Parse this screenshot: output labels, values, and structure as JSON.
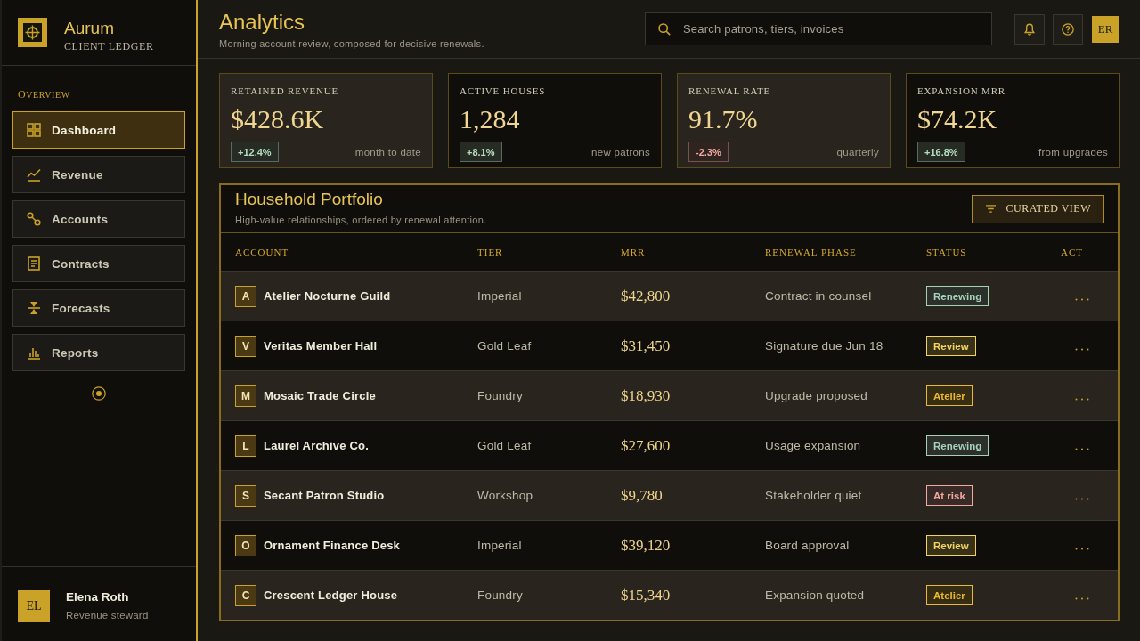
{
  "sidebar": {
    "brand": {
      "name": "Aurum",
      "tagline": "CLIENT LEDGER"
    },
    "section_label": "OVERVIEW",
    "items": [
      {
        "label": "Dashboard",
        "selected": true
      },
      {
        "label": "Revenue",
        "selected": false
      },
      {
        "label": "Accounts",
        "selected": false
      },
      {
        "label": "Contracts",
        "selected": false
      },
      {
        "label": "Forecasts",
        "selected": false
      },
      {
        "label": "Reports",
        "selected": false
      }
    ],
    "user": {
      "initials": "EL",
      "name": "Elena Roth",
      "role": "Revenue steward"
    }
  },
  "header": {
    "title": "Analytics",
    "subtitle": "Morning account review, composed for decisive renewals.",
    "search": {
      "placeholder": "Search patrons, tiers, invoices"
    },
    "avatar": "ER"
  },
  "kpis": [
    {
      "label": "RETAINED REVENUE",
      "value": "$428.6K",
      "delta": {
        "text": "+12.4%",
        "color": "#b5dcc0"
      },
      "caption": "month to date"
    },
    {
      "label": "ACTIVE HOUSES",
      "value": "1,284",
      "delta": {
        "text": "+8.1%",
        "color": "#b5dcc0"
      },
      "caption": "new patrons"
    },
    {
      "label": "RENEWAL RATE",
      "value": "91.7%",
      "delta": {
        "text": "-2.3%",
        "color": "#f2a9a0"
      },
      "caption": "quarterly"
    },
    {
      "label": "EXPANSION MRR",
      "value": "$74.2K",
      "delta": {
        "text": "+16.8%",
        "color": "#b5dcc0"
      },
      "caption": "from upgrades"
    }
  ],
  "portfolio": {
    "title": "Household Portfolio",
    "subtitle": "High-value relationships, ordered by renewal attention.",
    "action": "CURATED VIEW",
    "columns": [
      "ACCOUNT",
      "TIER",
      "MRR",
      "RENEWAL PHASE",
      "STATUS",
      "ACT"
    ],
    "rows": [
      {
        "initial": "A",
        "account": "Atelier Nocturne Guild",
        "tier": "Imperial",
        "mrr": "$42,800",
        "phase": "Contract in counsel",
        "status": {
          "label": "Renewing",
          "color": "#a8d0b8"
        }
      },
      {
        "initial": "V",
        "account": "Veritas Member Hall",
        "tier": "Gold Leaf",
        "mrr": "$31,450",
        "phase": "Signature due Jun 18",
        "status": {
          "label": "Review",
          "color": "#f2d35e"
        }
      },
      {
        "initial": "M",
        "account": "Mosaic Trade Circle",
        "tier": "Foundry",
        "mrr": "$18,930",
        "phase": "Upgrade proposed",
        "status": {
          "label": "Atelier",
          "color": "#e8b830"
        }
      },
      {
        "initial": "L",
        "account": "Laurel Archive Co.",
        "tier": "Gold Leaf",
        "mrr": "$27,600",
        "phase": "Usage expansion",
        "status": {
          "label": "Renewing",
          "color": "#a8d0b8"
        }
      },
      {
        "initial": "S",
        "account": "Secant Patron Studio",
        "tier": "Workshop",
        "mrr": "$9,780",
        "phase": "Stakeholder quiet",
        "status": {
          "label": "At risk",
          "color": "#f0a8a0"
        }
      },
      {
        "initial": "O",
        "account": "Ornament Finance Desk",
        "tier": "Imperial",
        "mrr": "$39,120",
        "phase": "Board approval",
        "status": {
          "label": "Review",
          "color": "#f2d35e"
        }
      },
      {
        "initial": "C",
        "account": "Crescent Ledger House",
        "tier": "Foundry",
        "mrr": "$15,340",
        "phase": "Expansion quoted",
        "status": {
          "label": "Atelier",
          "color": "#e8b830"
        }
      }
    ]
  }
}
